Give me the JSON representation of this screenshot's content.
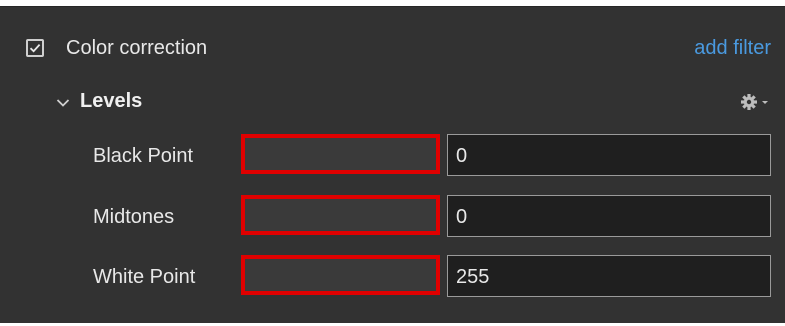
{
  "filter": {
    "title": "Color correction",
    "enabled": true,
    "add_filter_label": "add filter"
  },
  "section": {
    "title": "Levels",
    "expanded": true
  },
  "params": [
    {
      "label": "Black Point",
      "value": "0"
    },
    {
      "label": "Midtones",
      "value": "0"
    },
    {
      "label": "White Point",
      "value": "255"
    }
  ],
  "colors": {
    "panel_bg": "#323232",
    "field_bg": "#1f1f1f",
    "link": "#4a9ae0",
    "highlight": "#e00000"
  },
  "icons": [
    "checkbox-icon",
    "chevron-down-icon",
    "gear-icon"
  ]
}
